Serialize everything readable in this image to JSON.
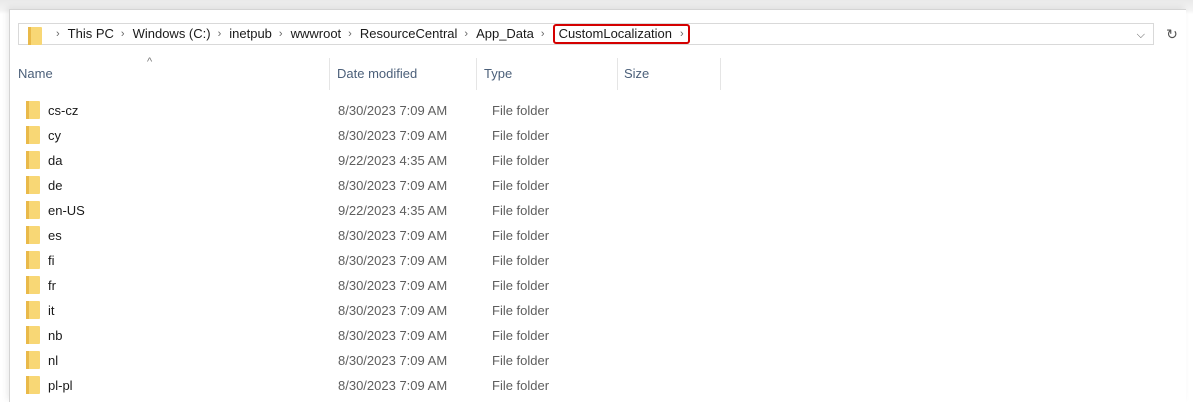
{
  "breadcrumb": {
    "items": [
      "This PC",
      "Windows (C:)",
      "inetpub",
      "wwwroot",
      "ResourceCentral",
      "App_Data"
    ],
    "current": "CustomLocalization"
  },
  "columns": {
    "name": "Name",
    "date_modified": "Date modified",
    "type": "Type",
    "size": "Size"
  },
  "icons": {
    "separator": "›",
    "sort": "^",
    "dropdown": "⌵",
    "refresh": "↻"
  },
  "files": [
    {
      "name": "cs-cz",
      "date": "8/30/2023 7:09 AM",
      "type": "File folder"
    },
    {
      "name": "cy",
      "date": "8/30/2023 7:09 AM",
      "type": "File folder"
    },
    {
      "name": "da",
      "date": "9/22/2023 4:35 AM",
      "type": "File folder"
    },
    {
      "name": "de",
      "date": "8/30/2023 7:09 AM",
      "type": "File folder"
    },
    {
      "name": "en-US",
      "date": "9/22/2023 4:35 AM",
      "type": "File folder"
    },
    {
      "name": "es",
      "date": "8/30/2023 7:09 AM",
      "type": "File folder"
    },
    {
      "name": "fi",
      "date": "8/30/2023 7:09 AM",
      "type": "File folder"
    },
    {
      "name": "fr",
      "date": "8/30/2023 7:09 AM",
      "type": "File folder"
    },
    {
      "name": "it",
      "date": "8/30/2023 7:09 AM",
      "type": "File folder"
    },
    {
      "name": "nb",
      "date": "8/30/2023 7:09 AM",
      "type": "File folder"
    },
    {
      "name": "nl",
      "date": "8/30/2023 7:09 AM",
      "type": "File folder"
    },
    {
      "name": "pl-pl",
      "date": "8/30/2023 7:09 AM",
      "type": "File folder"
    }
  ],
  "colors": {
    "highlight_border": "#d40000",
    "folder": "#f8d775",
    "header_text": "#4c607a"
  }
}
